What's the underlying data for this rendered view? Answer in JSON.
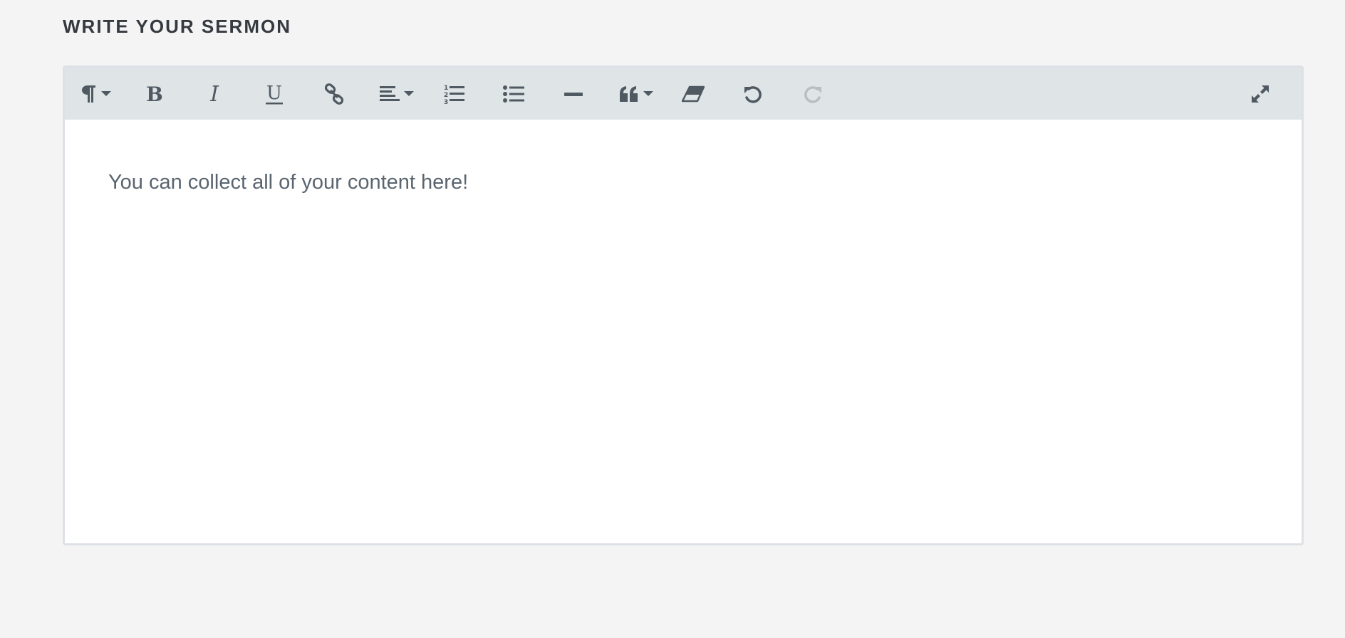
{
  "section": {
    "title": "WRITE YOUR SERMON"
  },
  "editor": {
    "content_text": "You can collect all of your content here!",
    "toolbar": {
      "icons": [
        "paragraph-format-icon",
        "bold-icon",
        "italic-icon",
        "underline-icon",
        "link-icon",
        "align-left-icon",
        "ordered-list-icon",
        "unordered-list-icon",
        "horizontal-rule-icon",
        "quote-icon",
        "clear-formatting-icon",
        "undo-icon",
        "redo-icon",
        "fullscreen-icon"
      ],
      "redo_disabled": true
    }
  },
  "colors": {
    "background": "#f4f4f4",
    "toolbar": "#dfe4e7",
    "icon": "#4f5962",
    "icon_disabled": "#b9bec2",
    "border": "#dde1e5",
    "text": "#5a6570",
    "title": "#343a40"
  }
}
